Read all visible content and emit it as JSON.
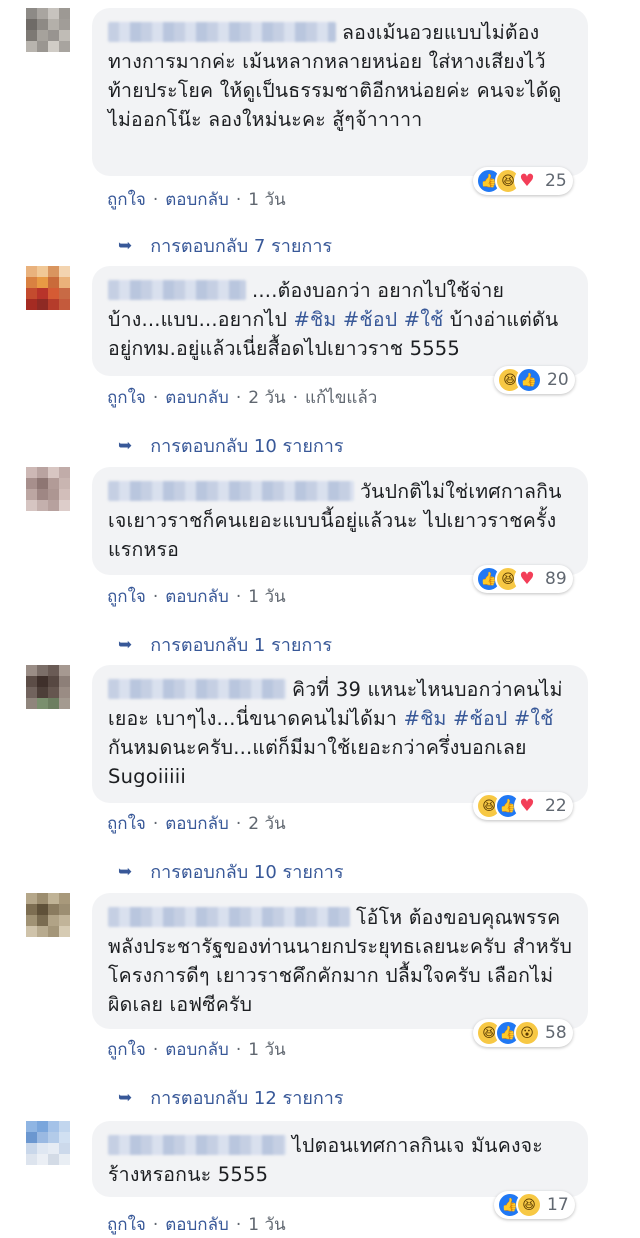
{
  "comments": [
    {
      "text": "ลองเม้นอวยแบบไม่ต้องทางการมากค่ะ เม้นหลากหลายหน่อย ใส่หางเสียงไว้ท้ายประโยค ให้ดูเป็นธรรมชาติอีกหน่อยค่ะ คนจะได้ดูไม่ออกโน๊ะ ลองใหม่นะคะ สู้ๆจ้าาาาา",
      "like_label": "ถูกใจ",
      "reply_label": "ตอบกลับ",
      "time": "1 วัน",
      "edited": "",
      "replies_label": "การตอบกลับ 7 รายการ",
      "reaction_count": "25",
      "reactions": [
        "like-icon",
        "haha-icon",
        "love-icon"
      ]
    },
    {
      "text_parts": [
        "....ต้องบอกว่า อยากไปใช้จ่ายบ้าง...แบบ...อยากไป ",
        "#ชิม",
        " ",
        "#ช้อป",
        " ",
        "#ใช้",
        " บ้างอ่าแต่ดันอยู่กทม.อยู่แล้วเนี่ยสื้อดไปเยาวราช 5555"
      ],
      "like_label": "ถูกใจ",
      "reply_label": "ตอบกลับ",
      "time": "2 วัน",
      "edited": "แก้ไขแล้ว",
      "replies_label": "การตอบกลับ 10 รายการ",
      "reaction_count": "20",
      "reactions": [
        "haha-icon",
        "like-icon"
      ]
    },
    {
      "text": "วันปกติไม่ใช่เทศกาลกินเจเยาวราชก็คนเยอะแบบนี้อยู่แล้วนะ ไปเยาวราชครั้งแรกหรอ",
      "like_label": "ถูกใจ",
      "reply_label": "ตอบกลับ",
      "time": "1 วัน",
      "edited": "",
      "replies_label": "การตอบกลับ 1 รายการ",
      "reaction_count": "89",
      "reactions": [
        "like-icon",
        "haha-icon",
        "love-icon"
      ]
    },
    {
      "text_parts": [
        "คิวที่ 39 แหนะไหนบอกว่าคนไม่เยอะ เบาๆไง...นี่ขนาดคนไม่ได้มา ",
        "#ชิม",
        " ",
        "#ช้อป",
        " ",
        "#ใช้",
        " กันหมดนะครับ...แต่ก็มีมาใช้เยอะกว่าครึ่งบอกเลย Sugoiiiii"
      ],
      "like_label": "ถูกใจ",
      "reply_label": "ตอบกลับ",
      "time": "2 วัน",
      "edited": "",
      "replies_label": "การตอบกลับ 10 รายการ",
      "reaction_count": "22",
      "reactions": [
        "haha-icon",
        "like-icon",
        "love-icon"
      ]
    },
    {
      "text": "โอ้โห ต้องขอบคุณพรรคพลังประชารัฐของท่านนายกประยุทธเลยนะครับ สำหรับโครงการดีๆ เยาวราชคึกคักมาก ปลื้มใจครับ เลือกไม่ผิดเลย เอฟซีครับ",
      "like_label": "ถูกใจ",
      "reply_label": "ตอบกลับ",
      "time": "1 วัน",
      "edited": "",
      "replies_label": "การตอบกลับ 12 รายการ",
      "reaction_count": "58",
      "reactions": [
        "haha-icon",
        "like-icon",
        "wow-icon"
      ]
    },
    {
      "text": "ไปตอนเทศกาลกินเจ มันคงจะร้างหรอกนะ 5555",
      "like_label": "ถูกใจ",
      "reply_label": "ตอบกลับ",
      "time": "1 วัน",
      "edited": "",
      "replies_label": "",
      "reaction_count": "17",
      "reactions": [
        "like-icon",
        "haha-icon"
      ]
    }
  ],
  "colors": {
    "link": "#385898",
    "bubble": "#f2f3f5",
    "meta": "#606770",
    "like": "#2078f4"
  }
}
